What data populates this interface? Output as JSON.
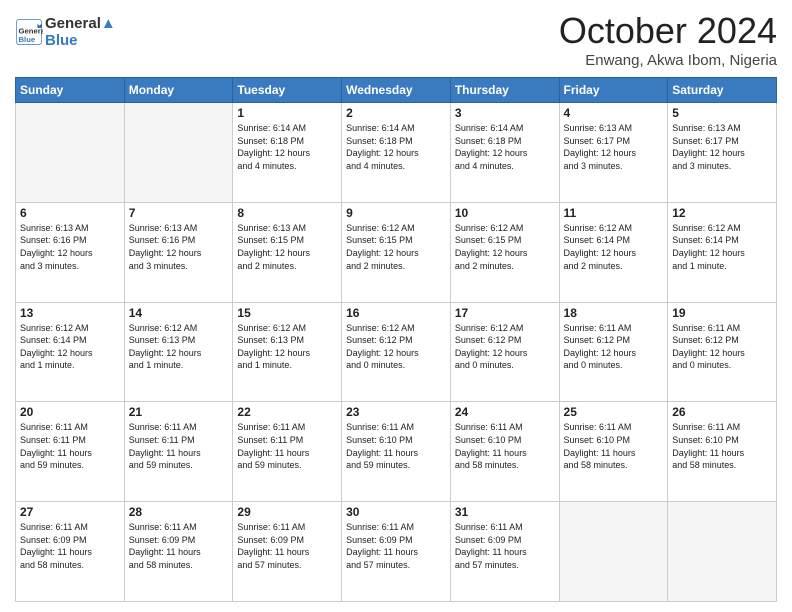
{
  "header": {
    "logo_line1": "General",
    "logo_line2": "Blue",
    "month_title": "October 2024",
    "location": "Enwang, Akwa Ibom, Nigeria"
  },
  "weekdays": [
    "Sunday",
    "Monday",
    "Tuesday",
    "Wednesday",
    "Thursday",
    "Friday",
    "Saturday"
  ],
  "weeks": [
    [
      {
        "day": "",
        "info": ""
      },
      {
        "day": "",
        "info": ""
      },
      {
        "day": "1",
        "info": "Sunrise: 6:14 AM\nSunset: 6:18 PM\nDaylight: 12 hours\nand 4 minutes."
      },
      {
        "day": "2",
        "info": "Sunrise: 6:14 AM\nSunset: 6:18 PM\nDaylight: 12 hours\nand 4 minutes."
      },
      {
        "day": "3",
        "info": "Sunrise: 6:14 AM\nSunset: 6:18 PM\nDaylight: 12 hours\nand 4 minutes."
      },
      {
        "day": "4",
        "info": "Sunrise: 6:13 AM\nSunset: 6:17 PM\nDaylight: 12 hours\nand 3 minutes."
      },
      {
        "day": "5",
        "info": "Sunrise: 6:13 AM\nSunset: 6:17 PM\nDaylight: 12 hours\nand 3 minutes."
      }
    ],
    [
      {
        "day": "6",
        "info": "Sunrise: 6:13 AM\nSunset: 6:16 PM\nDaylight: 12 hours\nand 3 minutes."
      },
      {
        "day": "7",
        "info": "Sunrise: 6:13 AM\nSunset: 6:16 PM\nDaylight: 12 hours\nand 3 minutes."
      },
      {
        "day": "8",
        "info": "Sunrise: 6:13 AM\nSunset: 6:15 PM\nDaylight: 12 hours\nand 2 minutes."
      },
      {
        "day": "9",
        "info": "Sunrise: 6:12 AM\nSunset: 6:15 PM\nDaylight: 12 hours\nand 2 minutes."
      },
      {
        "day": "10",
        "info": "Sunrise: 6:12 AM\nSunset: 6:15 PM\nDaylight: 12 hours\nand 2 minutes."
      },
      {
        "day": "11",
        "info": "Sunrise: 6:12 AM\nSunset: 6:14 PM\nDaylight: 12 hours\nand 2 minutes."
      },
      {
        "day": "12",
        "info": "Sunrise: 6:12 AM\nSunset: 6:14 PM\nDaylight: 12 hours\nand 1 minute."
      }
    ],
    [
      {
        "day": "13",
        "info": "Sunrise: 6:12 AM\nSunset: 6:14 PM\nDaylight: 12 hours\nand 1 minute."
      },
      {
        "day": "14",
        "info": "Sunrise: 6:12 AM\nSunset: 6:13 PM\nDaylight: 12 hours\nand 1 minute."
      },
      {
        "day": "15",
        "info": "Sunrise: 6:12 AM\nSunset: 6:13 PM\nDaylight: 12 hours\nand 1 minute."
      },
      {
        "day": "16",
        "info": "Sunrise: 6:12 AM\nSunset: 6:12 PM\nDaylight: 12 hours\nand 0 minutes."
      },
      {
        "day": "17",
        "info": "Sunrise: 6:12 AM\nSunset: 6:12 PM\nDaylight: 12 hours\nand 0 minutes."
      },
      {
        "day": "18",
        "info": "Sunrise: 6:11 AM\nSunset: 6:12 PM\nDaylight: 12 hours\nand 0 minutes."
      },
      {
        "day": "19",
        "info": "Sunrise: 6:11 AM\nSunset: 6:12 PM\nDaylight: 12 hours\nand 0 minutes."
      }
    ],
    [
      {
        "day": "20",
        "info": "Sunrise: 6:11 AM\nSunset: 6:11 PM\nDaylight: 11 hours\nand 59 minutes."
      },
      {
        "day": "21",
        "info": "Sunrise: 6:11 AM\nSunset: 6:11 PM\nDaylight: 11 hours\nand 59 minutes."
      },
      {
        "day": "22",
        "info": "Sunrise: 6:11 AM\nSunset: 6:11 PM\nDaylight: 11 hours\nand 59 minutes."
      },
      {
        "day": "23",
        "info": "Sunrise: 6:11 AM\nSunset: 6:10 PM\nDaylight: 11 hours\nand 59 minutes."
      },
      {
        "day": "24",
        "info": "Sunrise: 6:11 AM\nSunset: 6:10 PM\nDaylight: 11 hours\nand 58 minutes."
      },
      {
        "day": "25",
        "info": "Sunrise: 6:11 AM\nSunset: 6:10 PM\nDaylight: 11 hours\nand 58 minutes."
      },
      {
        "day": "26",
        "info": "Sunrise: 6:11 AM\nSunset: 6:10 PM\nDaylight: 11 hours\nand 58 minutes."
      }
    ],
    [
      {
        "day": "27",
        "info": "Sunrise: 6:11 AM\nSunset: 6:09 PM\nDaylight: 11 hours\nand 58 minutes."
      },
      {
        "day": "28",
        "info": "Sunrise: 6:11 AM\nSunset: 6:09 PM\nDaylight: 11 hours\nand 58 minutes."
      },
      {
        "day": "29",
        "info": "Sunrise: 6:11 AM\nSunset: 6:09 PM\nDaylight: 11 hours\nand 57 minutes."
      },
      {
        "day": "30",
        "info": "Sunrise: 6:11 AM\nSunset: 6:09 PM\nDaylight: 11 hours\nand 57 minutes."
      },
      {
        "day": "31",
        "info": "Sunrise: 6:11 AM\nSunset: 6:09 PM\nDaylight: 11 hours\nand 57 minutes."
      },
      {
        "day": "",
        "info": ""
      },
      {
        "day": "",
        "info": ""
      }
    ]
  ]
}
